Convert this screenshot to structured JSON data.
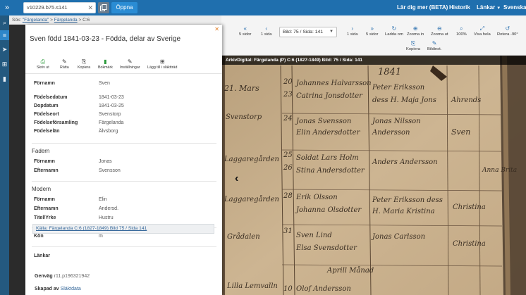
{
  "topbar": {
    "search_value": "v10229.b75.s141",
    "open_label": "Öppna",
    "links": [
      "Lär dig mer (BETA)",
      "Historik",
      "Länkar",
      "Svenska"
    ]
  },
  "breadcrumb": {
    "prefix": "Sök:",
    "items": [
      "Färgelanda",
      "Färgelanda",
      "C:6"
    ]
  },
  "viewer_toolbar": {
    "five_back": "5 sidor",
    "one_back": "1 sida",
    "page_select": "Bild: 75 / Sida: 141",
    "one_fwd": "1 sida",
    "five_fwd": "5 sidor",
    "reload": "Ladda om",
    "zoom_in": "Zooma in",
    "zoom_out": "Zooma ut",
    "hundred": "100%",
    "show_all": "Visa hela",
    "rotate": "Rotera -90°",
    "copy": "Kopiera",
    "image_settings": "Bildinst."
  },
  "viewer": {
    "image_title": "ArkivDigital: Färgelanda (P) C:6 (1827-1849) Bild: 75 / Sida: 141"
  },
  "record": {
    "title": "Sven född 1841-03-23 - Födda, delar av Sverige",
    "actions": [
      "Skriv ut",
      "Rätta",
      "Kopiera",
      "Bokmärk",
      "Inställningar",
      "Lägg till i släktträd"
    ],
    "person": [
      {
        "label": "Förnamn",
        "value": "Sven"
      },
      {
        "label": "Födelsedatum",
        "value": "1841-03-23"
      },
      {
        "label": "Dopdatum",
        "value": "1841-03-25"
      },
      {
        "label": "Födelseort",
        "value": "Svenstorp"
      },
      {
        "label": "Födelseförsamling",
        "value": "Färgelanda"
      },
      {
        "label": "Födelselän",
        "value": "Älvsborg"
      }
    ],
    "father_heading": "Fadern",
    "father": [
      {
        "label": "Förnamn",
        "value": "Jonas"
      },
      {
        "label": "Efternamn",
        "value": "Svensson"
      }
    ],
    "mother_heading": "Modern",
    "mother": [
      {
        "label": "Förnamn",
        "value": "Elin"
      },
      {
        "label": "Efternamn",
        "value": "Andersd."
      },
      {
        "label": "Titel/Yrke",
        "value": "Hustru"
      }
    ],
    "gender_label": "Kön",
    "gender_value": "m",
    "links_label": "Länkar",
    "source_link": "Källa: Färgelanda C:6 (1827-1849) Bild 75 / Sida 141",
    "shortcut_label": "Genväg",
    "shortcut_value": "r11.p196321942",
    "created_label": "Skapad av",
    "created_value": "Släktdata"
  },
  "ledger": {
    "year": "1841",
    "lines": [
      "21. Mars",
      "Svenstorp",
      "Laggaregården",
      "Laggaregården",
      "Grådalen",
      "Lilla Lemvalln",
      "20",
      "23",
      "24",
      "25",
      "26",
      "28",
      "31",
      "10",
      "Johannes Halvarsson",
      "Catrina Jonsdotter",
      "Jonas Svensson",
      "Elin Andersdotter",
      "Soldat Lars Holm",
      "Stina Andersdotter",
      "Erik Olsson",
      "Johanna Olsdotter",
      "Sven Lind",
      "Elsa Svensdotter",
      "Aprill Månad",
      "Olof Andersson",
      "Peter Eriksson",
      "dess H. Maja Jons",
      "Jonas Nilsson",
      "Andersson",
      "Anders Andersson",
      "Peter Eriksson dess",
      "H. Maria Kristina",
      "Jonas Carlsson",
      "Ahrends",
      "Sven",
      "Anna Brita",
      "Christina",
      "Christina"
    ]
  }
}
